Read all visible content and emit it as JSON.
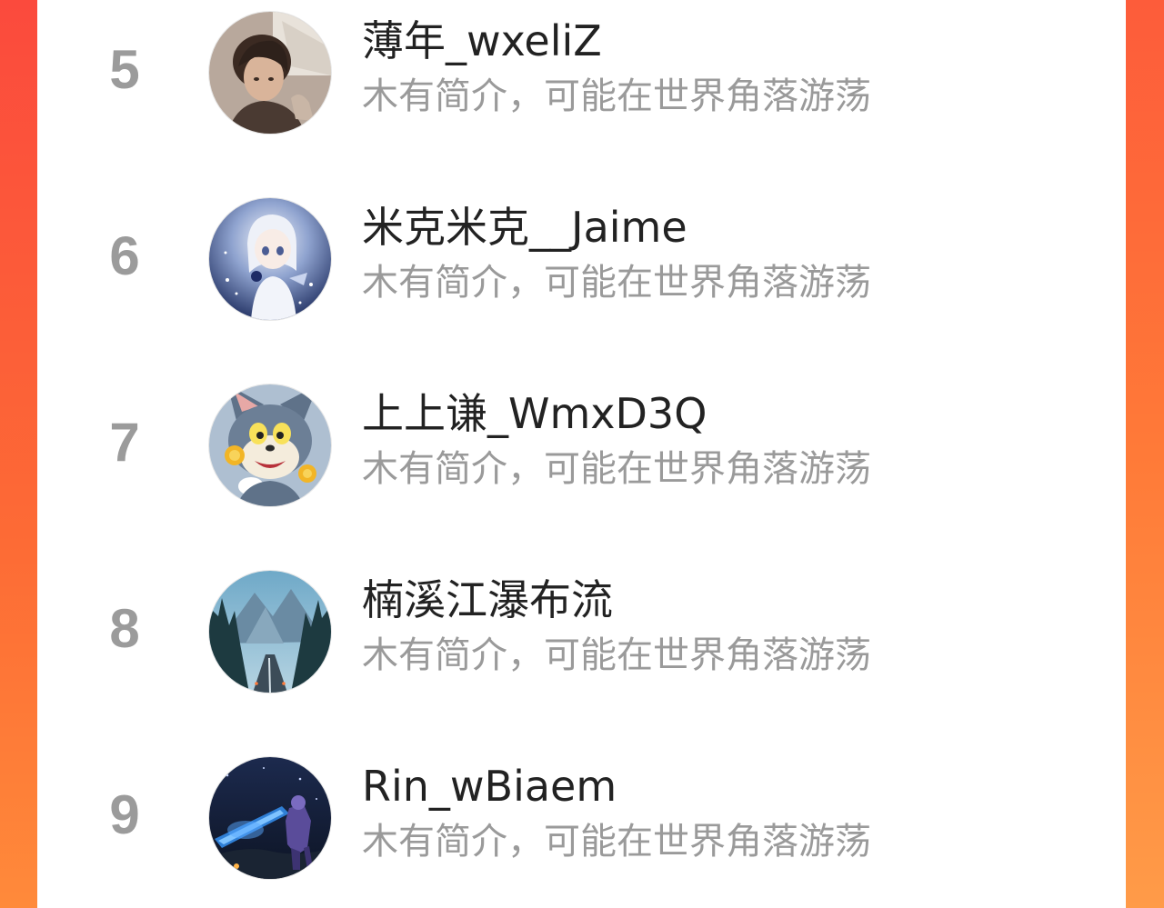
{
  "colors": {
    "accent_left": "#fb4a3d",
    "accent_right": "#ff8a3a",
    "rank_text": "#9b9b9b",
    "name_text": "#222222",
    "bio_text": "#9a9a9a"
  },
  "ranking": {
    "items": [
      {
        "rank": "5",
        "name": "薄年_wxeliZ",
        "bio": "木有简介，可能在世界角落游荡",
        "avatar_icon": "portrait-avatar-icon"
      },
      {
        "rank": "6",
        "name": "米克米克__Jaime",
        "bio": "木有简介，可能在世界角落游荡",
        "avatar_icon": "anime-girl-avatar-icon"
      },
      {
        "rank": "7",
        "name": "上上谦_WmxD3Q",
        "bio": "木有简介，可能在世界角落游荡",
        "avatar_icon": "cartoon-cat-avatar-icon"
      },
      {
        "rank": "8",
        "name": "楠溪江瀑布流",
        "bio": "木有简介，可能在世界角落游荡",
        "avatar_icon": "mountain-road-avatar-icon"
      },
      {
        "rank": "9",
        "name": "Rin_wBiaem",
        "bio": "木有简介，可能在世界角落游荡",
        "avatar_icon": "game-warrior-avatar-icon"
      }
    ]
  }
}
